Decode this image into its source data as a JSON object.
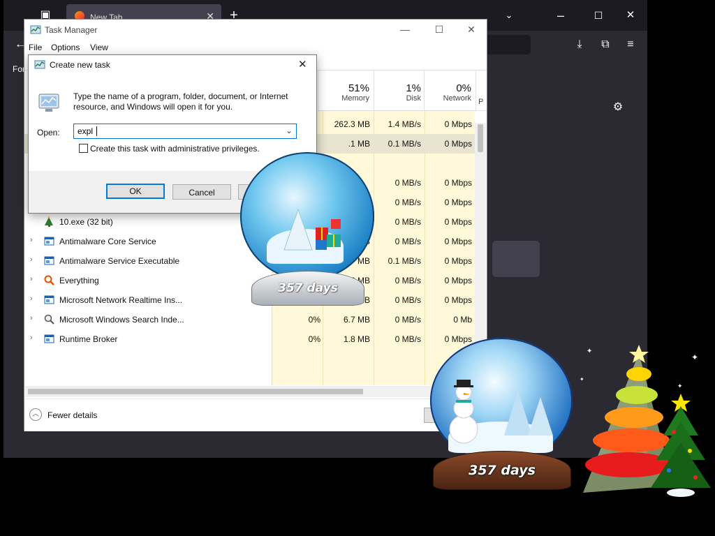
{
  "browser": {
    "tab_title": "New Tab",
    "side_label": "For"
  },
  "task_manager": {
    "title": "Task Manager",
    "menu": [
      "File",
      "Options",
      "View"
    ],
    "columns": {
      "memory": {
        "pct": "51%",
        "label": "Memory"
      },
      "disk": {
        "pct": "1%",
        "label": "Disk"
      },
      "network": {
        "pct": "0%",
        "label": "Network"
      },
      "extra": "P"
    },
    "rows": [
      {
        "name": "",
        "cpu": "",
        "memory": "262.3 MB",
        "disk": "1.4 MB/s",
        "network": "0 Mbps"
      },
      {
        "name": "",
        "cpu": "",
        "memory": ".1 MB",
        "disk": "0.1 MB/s",
        "network": "0 Mbps"
      },
      {
        "name": "",
        "cpu": "",
        "memory": "",
        "disk": "",
        "network": ""
      },
      {
        "name": "1.exe (32 bit)",
        "cpu": "",
        "memory": "",
        "disk": "0 MB/s",
        "network": "0 Mbps"
      },
      {
        "name": "3.exe (32 bit)",
        "cpu": "",
        "memory": "",
        "disk": "0 MB/s",
        "network": "0 Mbps"
      },
      {
        "name": "10.exe (32 bit)",
        "cpu": "",
        "memory": "",
        "disk": "0 MB/s",
        "network": "0 Mbps"
      },
      {
        "name": "Antimalware Core Service",
        "cpu": "",
        "memory": "MB",
        "disk": "0 MB/s",
        "network": "0 Mbps"
      },
      {
        "name": "Antimalware Service Executable",
        "cpu": "",
        "memory": "MB",
        "disk": "0.1 MB/s",
        "network": "0 Mbps"
      },
      {
        "name": "Everything",
        "cpu": "0%",
        "memory": "1.2 MB",
        "disk": "0 MB/s",
        "network": "0 Mbps"
      },
      {
        "name": "Microsoft Network Realtime Ins...",
        "cpu": "0%",
        "memory": "2.6 MB",
        "disk": "0 MB/s",
        "network": "0 Mbps"
      },
      {
        "name": "Microsoft Windows Search Inde...",
        "cpu": "0%",
        "memory": "6.7 MB",
        "disk": "0 MB/s",
        "network": "0 Mb"
      },
      {
        "name": "Runtime Broker",
        "cpu": "0%",
        "memory": "1.8 MB",
        "disk": "0 MB/s",
        "network": "0 Mbps"
      }
    ],
    "fewer_details": "Fewer details"
  },
  "dialog": {
    "title": "Create new task",
    "description": "Type the name of a program, folder, document, or Internet resource, and Windows will open it for you.",
    "open_label": "Open:",
    "open_value": "expl",
    "admin_checkbox_label": "Create this task with administrative privileges.",
    "admin_checked": false,
    "ok_label": "OK",
    "cancel_label": "Cancel"
  },
  "widgets": {
    "globe1_days": "357 days",
    "globe2_days": "357 days"
  },
  "colors": {
    "browser_bg": "#2b2a33",
    "tab_active": "#42414d",
    "cpu_highlight": "#fff4c4",
    "accent": "#0078d7"
  }
}
